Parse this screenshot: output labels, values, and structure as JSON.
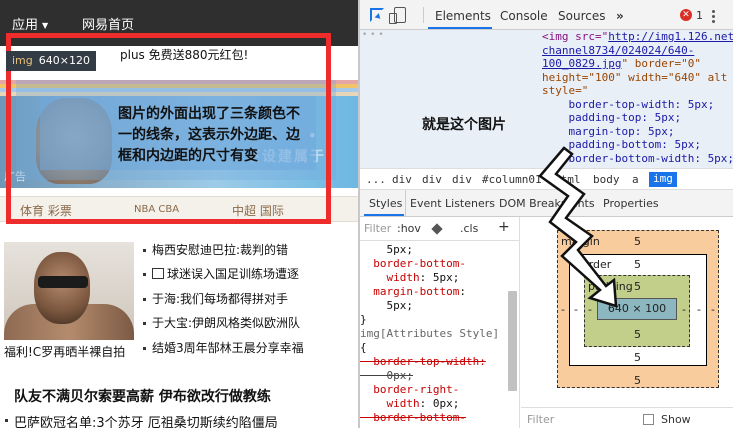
{
  "webpage": {
    "nav": {
      "app_label": "应用",
      "home_label": "网易首页"
    },
    "promo_text": "plus 免费送880元红包!",
    "inspect_badge": {
      "tag": "img",
      "size": "640×120"
    },
    "annotation": "图片的外面出现了三条颜色不一的线条，这表示外边距、边框和内边距的尺寸有变",
    "banner": {
      "dots": "• • • •",
      "sign_text": "下设建属于",
      "ad_label": "广告"
    },
    "categories": [
      "体育 彩票",
      "NBA CBA",
      "中超 国际"
    ],
    "photo_caption": "福利!C罗再晒半裸自拍",
    "news_items": [
      {
        "text": "梅西安慰迪巴拉:裁判的错",
        "video": false
      },
      {
        "text": "球迷误入国足训练场遭逐",
        "video": true
      },
      {
        "text": "于海:我们每场都得拼对手",
        "video": false
      },
      {
        "text": "于大宝:伊朗风格类似欧洲队",
        "video": false
      },
      {
        "text": "结婚3周年郜林王晨分享幸福",
        "video": false
      }
    ],
    "headline": "队友不满贝尔索要高薪 伊布欲改行做教练",
    "subline": "巴萨欧冠名单:3个苏牙 厄祖桑切斯续约陷僵局",
    "stripe_colors": [
      "#e5a6a6",
      "#f2c46a",
      "#a9c9e8",
      "#e7d6b7",
      "#bcd99c"
    ]
  },
  "devtools": {
    "tabs": [
      "Elements",
      "Console",
      "Sources",
      "»"
    ],
    "active_tab": "Elements",
    "error_count": "1",
    "error_icon": "✕",
    "dom_label": "就是这个图片",
    "dom_code": {
      "l1a": "<img src=\"",
      "l1b": "http://img1.126.net",
      "l2": "channel8734/024024/640-",
      "l3": "100_0829.jpg",
      "l3b": "\" border=\"0\"",
      "l4": "height=\"100\" width=\"640\" alt",
      "l5": "style=\"",
      "l6": "    border-top-width: 5px;",
      "l7": "    padding-top: 5px;",
      "l8": "    margin-top: 5px;",
      "l9": "    padding-bottom: 5px;",
      "l10": "    border-bottom-width: 5px;"
    },
    "breadcrumbs": [
      "...",
      "div",
      "div",
      "div",
      "#column01",
      "html",
      "body",
      "a",
      "img"
    ],
    "styles_tabs": [
      "Styles",
      "Event Listeners",
      "DOM Breakpoints",
      "Properties"
    ],
    "styles_filter": {
      "placeholder": "Filter",
      "hov": ":hov",
      "cls": ".cls",
      "plus": "+"
    },
    "css_code": {
      "c1": "    5px;",
      "c2a": "  border-bottom-",
      "c2b": "    width",
      "c2c": ": 5px;",
      "c3a": "  margin-bottom",
      "c3b": ":",
      "c4": "    5px;",
      "c5": "}",
      "c6": "img[Attributes Style]",
      "c7": "{",
      "c8a": "  border-top-width:",
      "c8b": "    0px;",
      "c9a": "  border-right-",
      "c9b": "    width",
      "c9c": ": 0px;",
      "c10": "  border-bottom-"
    },
    "box_model": {
      "margin_label": "margin",
      "border_label": "border",
      "padding_label": "padding",
      "content": "640 × 100",
      "margin": {
        "top": "5",
        "bottom": "5",
        "left": "-",
        "right": "-"
      },
      "border": {
        "top": "5",
        "bottom": "5",
        "left": "-",
        "right": "-"
      },
      "padding": {
        "top": "5",
        "bottom": "5",
        "left": "-",
        "right": "-"
      }
    },
    "box_filter_placeholder": "Filter",
    "show_label": "Show"
  }
}
